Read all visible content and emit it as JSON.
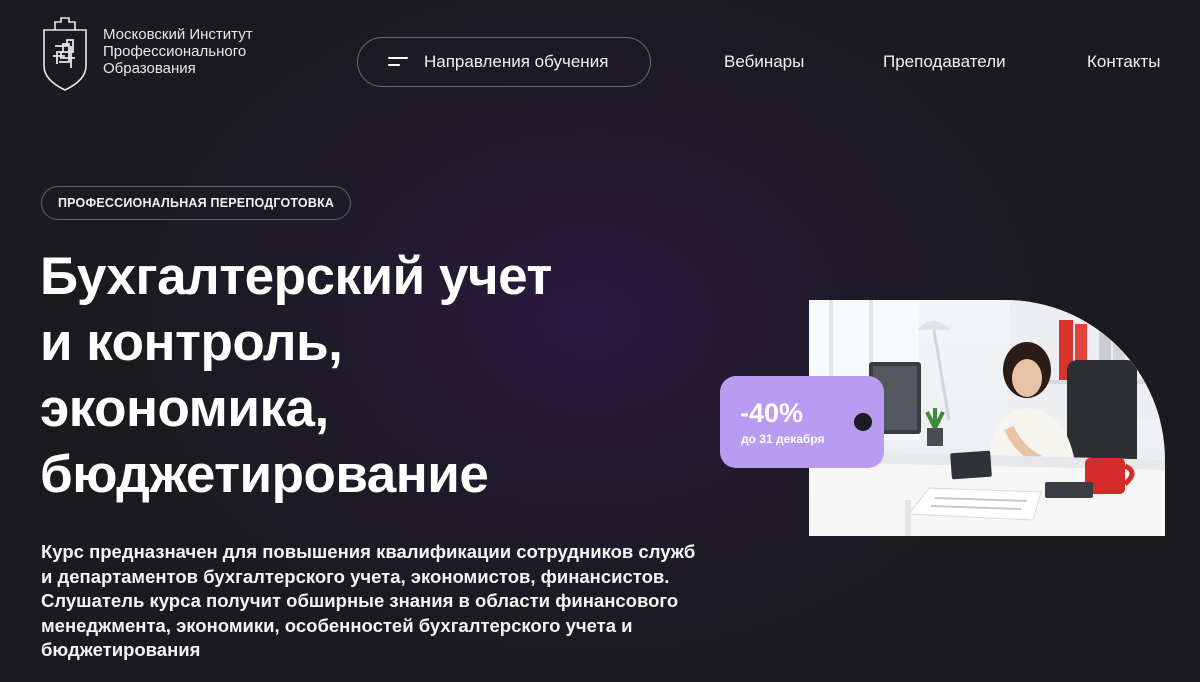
{
  "header": {
    "logo_lines": [
      "Московский Институт",
      "Профессионального",
      "Образования"
    ],
    "directions_label": "Направления обучения",
    "nav": {
      "webinars": "Вебинары",
      "teachers": "Преподаватели",
      "contacts": "Контакты"
    }
  },
  "hero": {
    "badge": "ПРОФЕССИОНАЛЬНАЯ ПЕРЕПОДГОТОВКА",
    "title_lines": [
      "Бухгалтерский учет",
      "и контроль,",
      "экономика,",
      "бюджетирование"
    ],
    "description": "Курс предназначен для повышения квалификации сотрудников служб и департаментов бухгалтерского учета, экономистов, финансистов. Слушатель курса получит обширные знания в области финансового менеджмента, экономики, особенностей бухгалтерского учета и бюджетирования"
  },
  "discount": {
    "value": "-40%",
    "note": "до 31 декабря",
    "color": "#b79cf2"
  },
  "colors": {
    "background": "#1b1b1f",
    "accent_glow": "#2c1a42"
  },
  "icons": {
    "logo": "shield-logo-icon",
    "menu": "burger-menu-icon"
  }
}
